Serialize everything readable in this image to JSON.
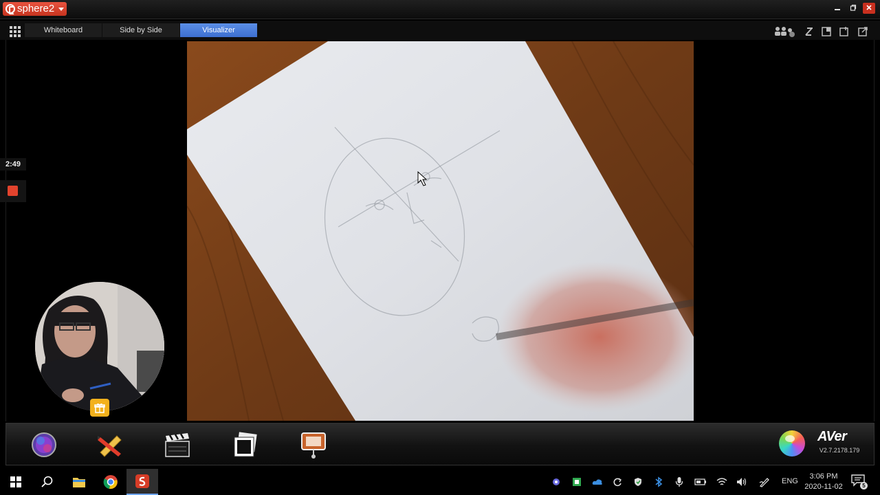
{
  "window": {
    "app_name": "sphere2",
    "controls": [
      "minimize-icon",
      "restore-icon",
      "close-icon"
    ]
  },
  "toolbar": {
    "tabs": [
      {
        "label": "Whiteboard",
        "active": false
      },
      {
        "label": "Side by Side",
        "active": false
      },
      {
        "label": "Visualizer",
        "active": true
      }
    ],
    "right_icons": [
      "participants-icon",
      "pen-tool-icon",
      "window-icon",
      "capture-icon",
      "external-link-icon"
    ]
  },
  "recording": {
    "elapsed": "2:49",
    "stop_color": "#e2432d"
  },
  "dock": {
    "icons": [
      "color-sphere-icon",
      "pencil-ruler-icon",
      "clapperboard-icon",
      "snapshot-frames-icon",
      "presentation-board-icon"
    ],
    "brand": "AVer",
    "version": "V2.7.2178.179"
  },
  "taskbar": {
    "pinned": [
      "windows-start-icon",
      "search-icon",
      "file-explorer-icon",
      "chrome-icon",
      "sphere2-icon"
    ],
    "tray": [
      "puzzle-icon",
      "green-app-icon",
      "onedrive-icon",
      "sync-icon",
      "defender-icon",
      "bluetooth-icon",
      "microphone-icon",
      "battery-icon",
      "wifi-icon",
      "volume-icon",
      "pen-icon"
    ],
    "language": "ENG",
    "time": "3:06 PM",
    "date": "2020-11-02",
    "notification_count": "5"
  },
  "colors": {
    "accent": "#4a7ee0",
    "titlebar": "#111111",
    "brand_red": "#d63c27"
  }
}
